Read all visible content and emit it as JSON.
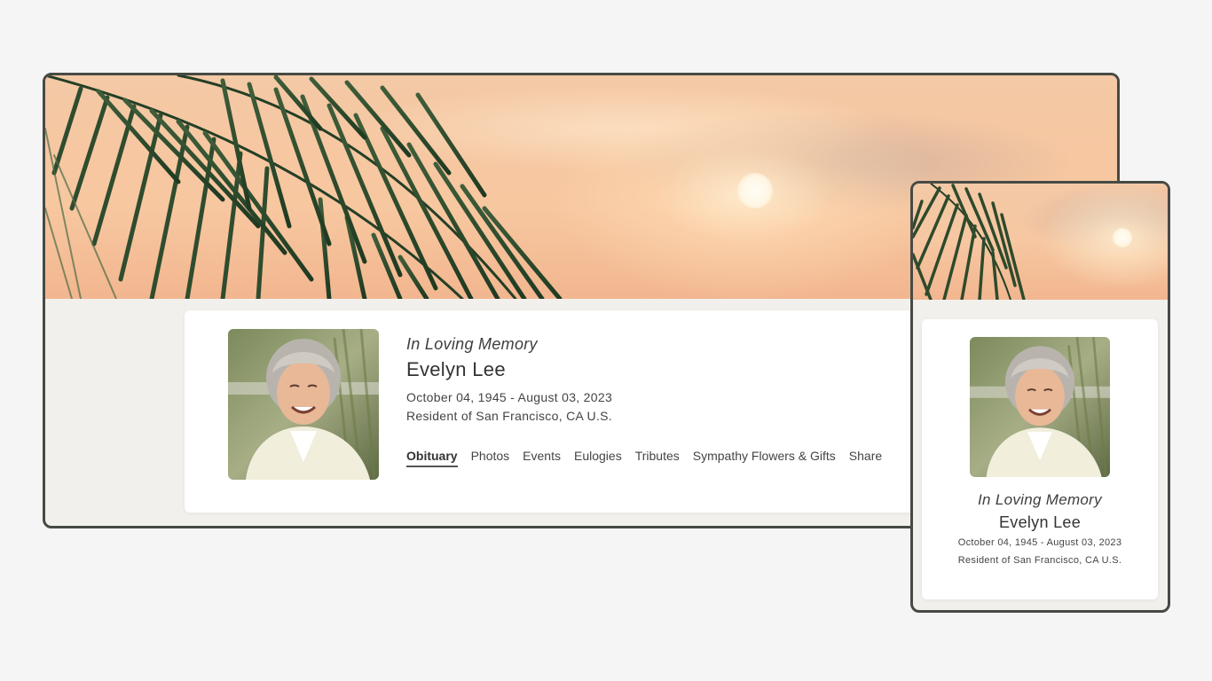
{
  "memorial": {
    "heading": "In Loving Memory",
    "name": "Evelyn Lee",
    "dates": "October 04, 1945 - August 03, 2023",
    "residence": "Resident of San Francisco, CA U.S."
  },
  "nav": {
    "tabs": [
      "Obituary",
      "Photos",
      "Events",
      "Eulogies",
      "Tributes",
      "Sympathy Flowers & Gifts",
      "Share"
    ],
    "active": "Obituary"
  },
  "colors": {
    "page_background": "#f5f5f5",
    "frame_border": "#474a44",
    "content_background": "#f2f0ec",
    "card_background": "#ffffff",
    "text": "#333333",
    "sky": "#f6c7a1",
    "palm": "#2e4a2c"
  },
  "images": {
    "hero": "palm-tree-sunset-banner",
    "portrait": "smiling-elderly-woman-portrait"
  }
}
